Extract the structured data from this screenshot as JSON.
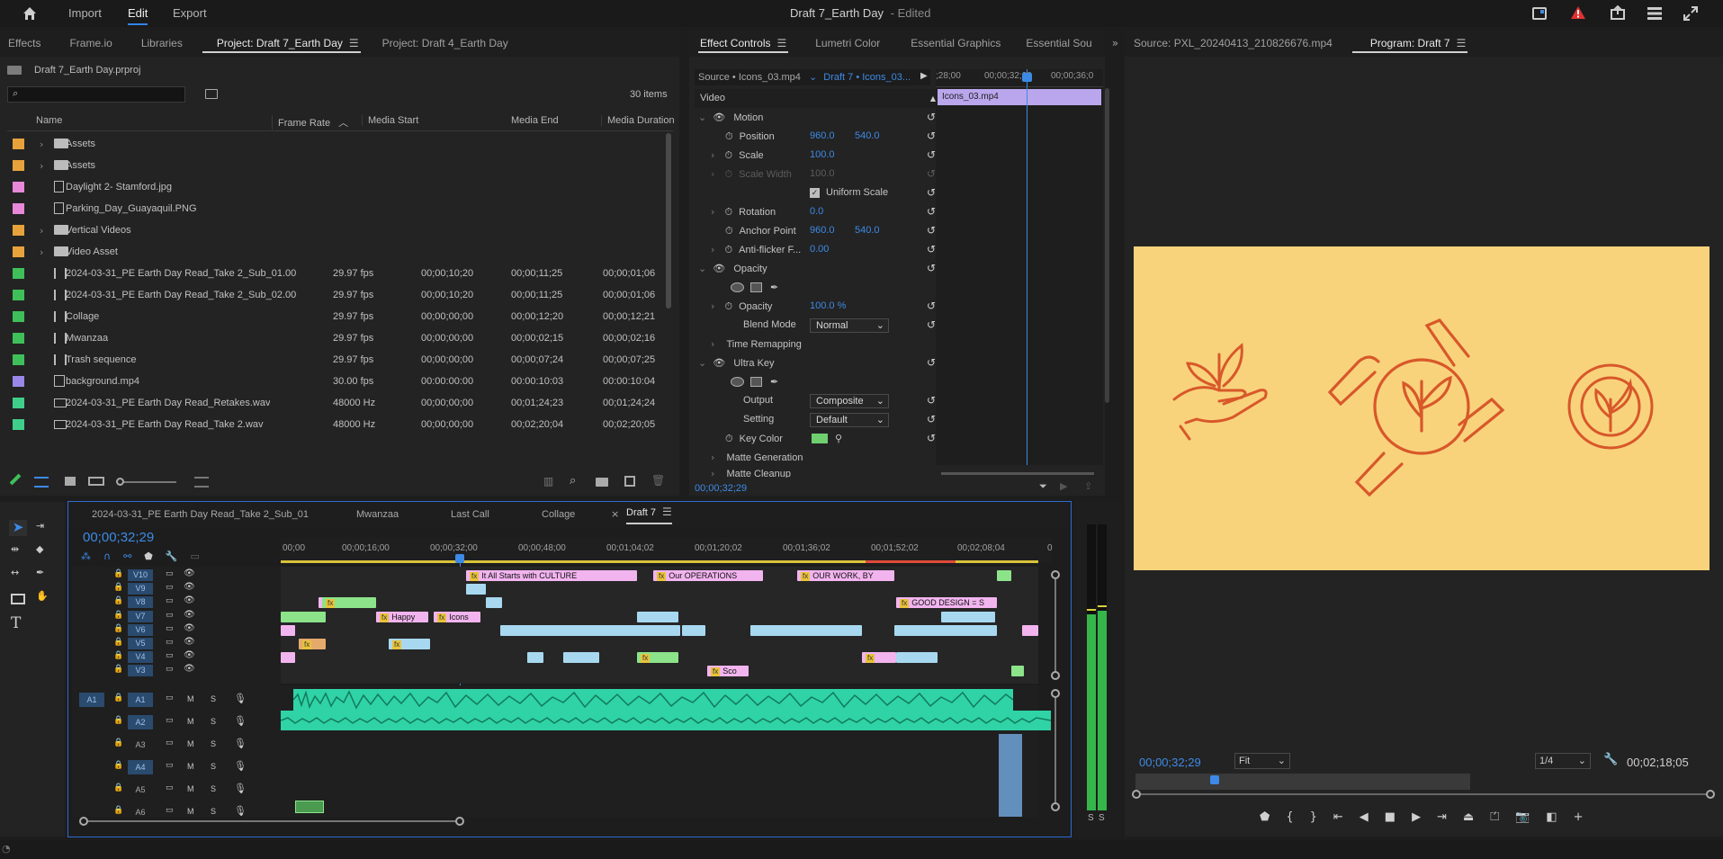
{
  "topbar": {
    "menus": [
      "Import",
      "Edit",
      "Export"
    ],
    "title": "Draft 7_Earth Day",
    "edited": "- Edited"
  },
  "project_panel": {
    "tabs": [
      "Effects",
      "Frame.io",
      "Libraries",
      "Project: Draft 7_Earth Day",
      "Project: Draft 4_Earth Day"
    ],
    "file": "Draft 7_Earth Day.prproj",
    "search_placeholder": "",
    "item_count": "30 items",
    "columns": [
      "Name",
      "Frame Rate",
      "Media Start",
      "Media End",
      "Media Duration"
    ],
    "rows": [
      {
        "name": "Assets",
        "color": "#e8a23c",
        "kind": "folder",
        "rate": "",
        "start": "",
        "end": "",
        "dur": ""
      },
      {
        "name": "Assets",
        "color": "#e8a23c",
        "kind": "folder",
        "rate": "",
        "start": "",
        "end": "",
        "dur": ""
      },
      {
        "name": "Daylight 2- Stamford.jpg",
        "color": "#e888d8",
        "kind": "image",
        "rate": "",
        "start": "",
        "end": "",
        "dur": ""
      },
      {
        "name": "Parking_Day_Guayaquil.PNG",
        "color": "#e888d8",
        "kind": "image",
        "rate": "",
        "start": "",
        "end": "",
        "dur": ""
      },
      {
        "name": "Vertical Videos",
        "color": "#e8a23c",
        "kind": "folder",
        "rate": "",
        "start": "",
        "end": "",
        "dur": ""
      },
      {
        "name": "Video Asset",
        "color": "#e8a23c",
        "kind": "folder",
        "rate": "",
        "start": "",
        "end": "",
        "dur": ""
      },
      {
        "name": "2024-03-31_PE Earth Day Read_Take 2_Sub_01.00",
        "color": "#3fbf5a",
        "kind": "sequence",
        "rate": "29.97 fps",
        "start": "00;00;10;20",
        "end": "00;00;11;25",
        "dur": "00;00;01;06"
      },
      {
        "name": "2024-03-31_PE Earth Day Read_Take 2_Sub_02.00",
        "color": "#3fbf5a",
        "kind": "sequence",
        "rate": "29.97 fps",
        "start": "00;00;10;20",
        "end": "00;00;11;25",
        "dur": "00;00;01;06"
      },
      {
        "name": "Collage",
        "color": "#3fbf5a",
        "kind": "sequence",
        "rate": "29.97 fps",
        "start": "00;00;00;00",
        "end": "00;00;12;20",
        "dur": "00;00;12;21"
      },
      {
        "name": "Mwanzaa",
        "color": "#3fbf5a",
        "kind": "sequence",
        "rate": "29.97 fps",
        "start": "00;00;00;00",
        "end": "00;00;02;15",
        "dur": "00;00;02;16"
      },
      {
        "name": "Trash sequence",
        "color": "#3fbf5a",
        "kind": "sequence",
        "rate": "29.97 fps",
        "start": "00;00;00;00",
        "end": "00;00;07;24",
        "dur": "00;00;07;25"
      },
      {
        "name": "background.mp4",
        "color": "#9a88e8",
        "kind": "video",
        "rate": "30.00 fps",
        "start": "00:00:00:00",
        "end": "00:00:10:03",
        "dur": "00:00:10:04"
      },
      {
        "name": "2024-03-31_PE Earth Day Read_Retakes.wav",
        "color": "#3fcf8a",
        "kind": "audio",
        "rate": "48000 Hz",
        "start": "00;00;00;00",
        "end": "00;01;24;23",
        "dur": "00;01;24;24"
      },
      {
        "name": "2024-03-31_PE Earth Day Read_Take 2.wav",
        "color": "#3fcf8a",
        "kind": "audio",
        "rate": "48000 Hz",
        "start": "00;00;00;00",
        "end": "00;02;20;04",
        "dur": "00;02;20;05"
      }
    ]
  },
  "effect_controls": {
    "tabs": [
      "Effect Controls",
      "Lumetri Color",
      "Essential Graphics",
      "Essential Sou"
    ],
    "source_label": "Source • Icons_03.mp4",
    "sequence_label": "Draft 7 • Icons_03...",
    "ruler": [
      ";28;00",
      "00;00;32;00",
      "00;00;36;0"
    ],
    "clip_name": "Icons_03.mp4",
    "section_video": "Video",
    "motion": "Motion",
    "position_label": "Position",
    "position_x": "960.0",
    "position_y": "540.0",
    "scale_label": "Scale",
    "scale_value": "100.0",
    "scale_width_label": "Scale Width",
    "scale_width_value": "100.0",
    "uniform_scale": "Uniform Scale",
    "rotation_label": "Rotation",
    "rotation_value": "0.0",
    "anchor_label": "Anchor Point",
    "anchor_x": "960.0",
    "anchor_y": "540.0",
    "antiflicker_label": "Anti-flicker F...",
    "antiflicker_value": "0.00",
    "opacity_section": "Opacity",
    "opacity_label": "Opacity",
    "opacity_value": "100.0 %",
    "blend_label": "Blend Mode",
    "blend_value": "Normal",
    "time_remap": "Time Remapping",
    "ultra_key": "Ultra Key",
    "output_label": "Output",
    "output_value": "Composite",
    "setting_label": "Setting",
    "setting_value": "Default",
    "key_color_label": "Key Color",
    "key_color": "#6fcf6f",
    "matte_generation": "Matte Generation",
    "matte_cleanup": "Matte Cleanup",
    "timecode": "00;00;32;29"
  },
  "program_monitor": {
    "source_tab": "Source: PXL_20240413_210826676.mp4",
    "program_tab": "Program: Draft 7",
    "timecode": "00;00;32;29",
    "fit": "Fit",
    "resolution": "1/4",
    "duration": "00;02;18;05",
    "frame_bg": "#f8d37c",
    "icon_color": "#d8582a"
  },
  "timeline": {
    "tabs": [
      "2024-03-31_PE Earth Day Read_Take 2_Sub_01",
      "Mwanzaa",
      "Last Call",
      "Collage",
      "Draft 7"
    ],
    "timecode": "00;00;32;29",
    "ruler": [
      "00;00",
      "00;00;16;00",
      "00;00;32;00",
      "00;00;48;00",
      "00;01;04;02",
      "00;01;20;02",
      "00;01;36;02",
      "00;01;52;02",
      "00;02;08;04",
      "0"
    ],
    "video_tracks": [
      "V10",
      "V9",
      "V8",
      "V7",
      "V6",
      "V5",
      "V4",
      "V3"
    ],
    "audio_tracks": [
      "A1",
      "A2",
      "A3",
      "A4",
      "A5",
      "A6"
    ],
    "source_patch": "A1",
    "clip_labels": {
      "culture": "It All Starts with CULTURE",
      "operations": "Our OPERATIONS",
      "work": "OUR WORK, BY",
      "design": "GOOD DESIGN = S",
      "happy": "Happy",
      "icons": "Icons",
      "sco": "Sco"
    },
    "meter_labels": [
      "S",
      "S"
    ]
  }
}
